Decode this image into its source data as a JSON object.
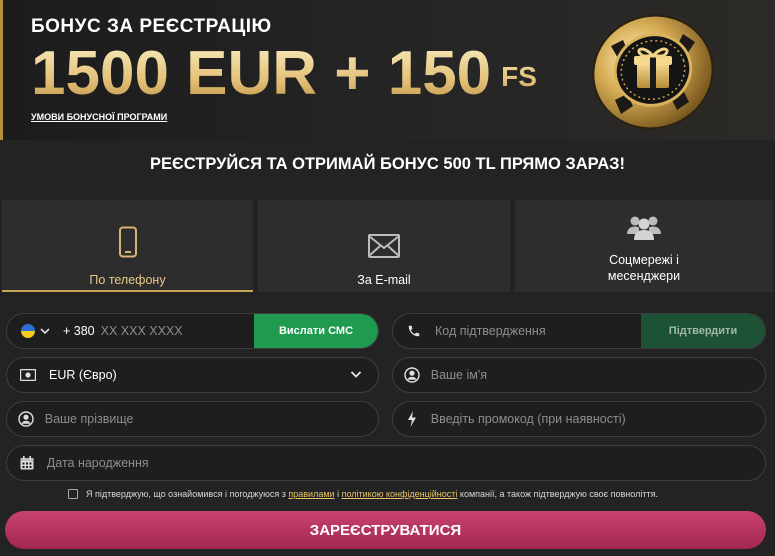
{
  "banner": {
    "title": "БОНУС ЗА РЕЄСТРАЦІЮ",
    "amount": "1500 EUR + 150",
    "amount_suffix": "FS",
    "terms_link": "УМОВИ БОНУСНОЇ ПРОГРАМИ"
  },
  "headline": "РЕЄСТРУЙСЯ ТА ОТРИМАЙ БОНУС 500 TL ПРЯМО ЗАРАЗ!",
  "tabs": [
    {
      "label": "По телефону",
      "icon": "phone-icon",
      "active": true
    },
    {
      "label": "За E-mail",
      "icon": "envelope-icon",
      "active": false
    },
    {
      "label": "Соцмережі і\nмесенджери",
      "icon": "users-icon",
      "active": false
    }
  ],
  "form": {
    "phone": {
      "prefix": "+ 380",
      "placeholder": "XX XXX XXXX",
      "country_flag": "ukraine-flag",
      "send_sms_label": "Вислати СМС"
    },
    "code": {
      "placeholder": "Код підтвердження",
      "confirm_label": "Підтвердити"
    },
    "currency": {
      "value": "EUR (Євро)"
    },
    "name": {
      "placeholder": "Ваше ім'я"
    },
    "surname": {
      "placeholder": "Ваше прізвище"
    },
    "promo": {
      "placeholder": "Введіть промокод (при наявності)"
    },
    "birthdate": {
      "placeholder": "Дата народження"
    }
  },
  "consent": {
    "text_before": "Я підтверджую, що ознайомився і погоджуюся з",
    "rules_link": "правилами",
    "and": "і",
    "privacy_link": "політикою конфіденційності",
    "text_after": "компанії, а також підтверджую своє повноліття."
  },
  "submit_label": "ЗАРЕЄСТРУВАТИСЯ",
  "colors": {
    "background": "#232323",
    "gold": "#e8c889",
    "green": "#1f9a4f",
    "submit": "#b5325e"
  }
}
